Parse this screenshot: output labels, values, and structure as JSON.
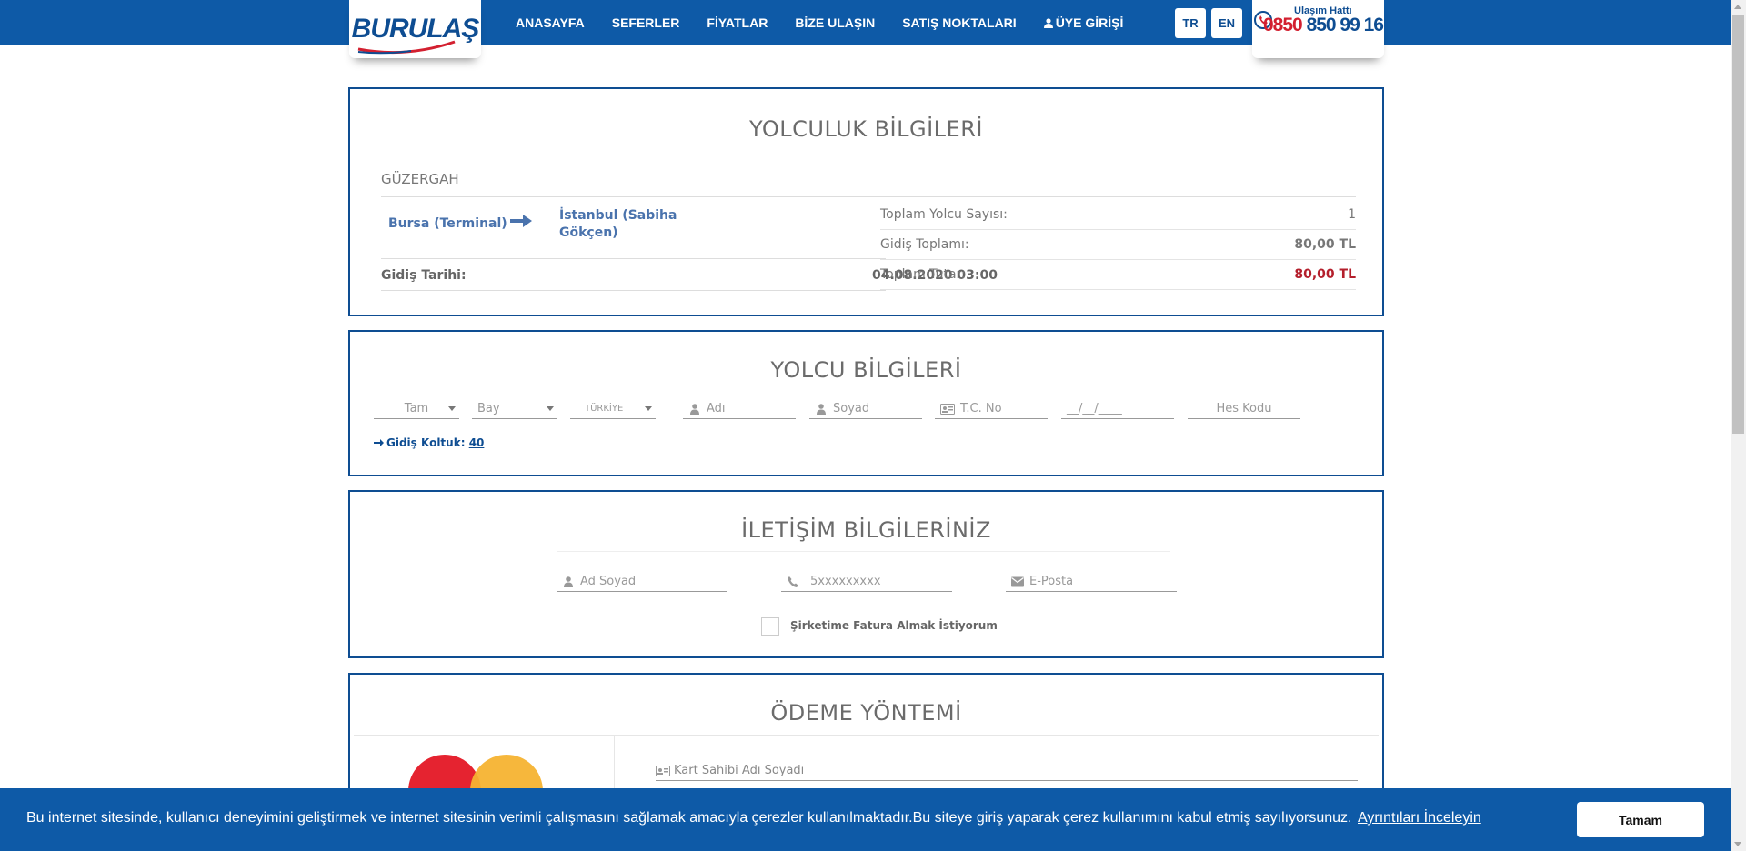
{
  "brand": {
    "logo_text": "BURULAŞ"
  },
  "nav": {
    "items": [
      "ANASAYFA",
      "SEFERLER",
      "FİYATLAR",
      "BİZE ULAŞIN",
      "SATIŞ NOKTALARI",
      "ÜYE GİRİŞİ"
    ]
  },
  "lang": {
    "tr": "TR",
    "en": "EN"
  },
  "hotline": {
    "label": "Ulaşım Hattı",
    "number_red": "0850",
    "number_blue": "850 99 16"
  },
  "journey": {
    "title": "YOLCULUK BİLGİLERİ",
    "route_label": "GÜZERGAH",
    "from": "Bursa (Terminal)",
    "to": "İstanbul (Sabiha Gökçen)",
    "departure_label": "Gidiş Tarihi:",
    "departure_value": "04.08.2020 03:00",
    "summary": [
      {
        "label": "Toplam Yolcu Sayısı:",
        "value": "1"
      },
      {
        "label": "Gidiş Toplamı:",
        "value": "80,00 TL"
      },
      {
        "label": "Toplam Tutar:",
        "value": "80,00 TL"
      }
    ]
  },
  "passenger": {
    "title": "YOLCU BİLGİLERİ",
    "ticket_type": "Tam",
    "gender": "Bay",
    "nationality": "TÜRKİYE",
    "first_name_placeholder": "Adı",
    "last_name_placeholder": "Soyad",
    "tc_placeholder": "T.C. No",
    "birthdate_placeholder": "__/__/____",
    "hes_placeholder": "Hes Kodu",
    "seat_label": "Gidiş Koltuk:",
    "seat_number": "40"
  },
  "contact": {
    "title": "İLETİŞİM BİLGİLERİNİZ",
    "name_placeholder": "Ad Soyad",
    "phone_placeholder": "5xxxxxxxxx",
    "email_placeholder": "E-Posta",
    "invoice_label": "Şirketime Fatura Almak İstiyorum"
  },
  "payment": {
    "title": "ÖDEME YÖNTEMİ",
    "cardholder_placeholder": "Kart Sahibi Adı Soyadı"
  },
  "cookie": {
    "text": "Bu internet sitesinde, kullanıcı deneyimini geliştirmek ve internet sitesinin verimli çalışmasını sağlamak amacıyla çerezler kullanılmaktadır.Bu siteye giriş yaparak çerez kullanımını kabul etmiş sayılıyorsunuz.",
    "link": "Ayrıntıları İnceleyin",
    "button": "Tamam"
  },
  "colors": {
    "primary": "#0e5aa7",
    "border": "#0e4d92",
    "total_red": "#b41f2c",
    "route_blue": "#4a73ad"
  }
}
